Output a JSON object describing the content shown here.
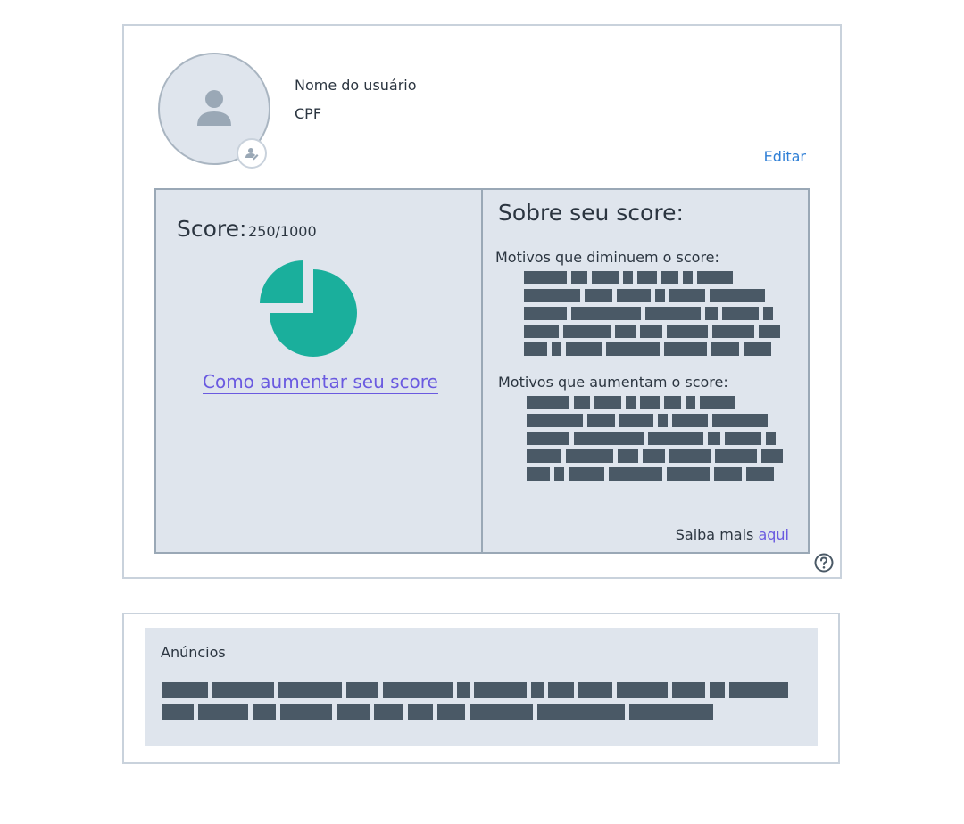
{
  "profile": {
    "name": "Nome do usuário",
    "cpf": "CPF",
    "edit_label": "Editar"
  },
  "score": {
    "label": "Score:",
    "value": "250/1000",
    "pie_fraction_highlighted": 0.25,
    "colors": {
      "pie": "#1aaf9c",
      "highlight": "#1aaf9c"
    },
    "improve_link": "Como aumentar seu score"
  },
  "about": {
    "title": "Sobre seu score:",
    "decrease_label": "Motivos que diminuem o score:",
    "increase_label": "Motivos que aumentam o score:",
    "learn_more_prefix": "Saiba mais",
    "learn_more_link": "aqui"
  },
  "ads": {
    "title": "Anúncios"
  },
  "icons": {
    "avatar": "user-silhouette-icon",
    "avatar_badge": "user-edit-icon",
    "help": "question-circle-icon"
  },
  "colors": {
    "panel": "#dfe5ed",
    "border": "#9aa8b6",
    "link_blue": "#2f7fd6",
    "link_purple": "#6a5ae0",
    "redacted_block": "#4a5966"
  }
}
